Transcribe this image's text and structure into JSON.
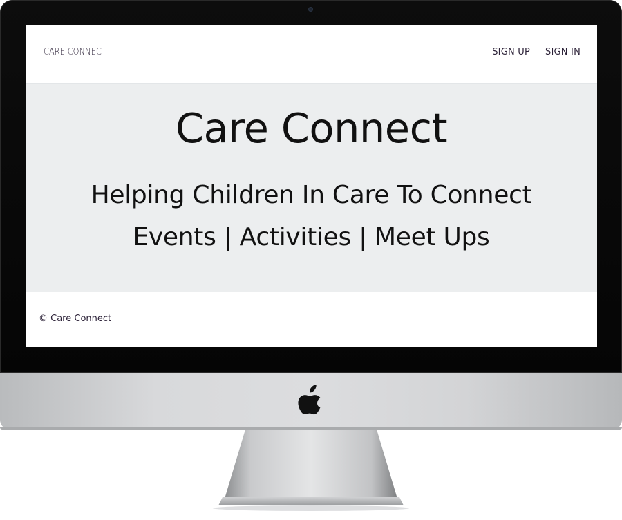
{
  "navbar": {
    "brand": "CARE CONNECT",
    "links": [
      {
        "label": "SIGN UP"
      },
      {
        "label": "SIGN IN"
      }
    ]
  },
  "hero": {
    "title": "Care Connect",
    "subtitle": "Helping Children In Care To Connect",
    "tagline": "Events | Activities | Meet Ups"
  },
  "footer": {
    "copyright": "© Care Connect"
  },
  "colors": {
    "hero_background": "#eceeef",
    "text_dark": "#111111",
    "nav_text": "#2c2238",
    "bezel": "#0d0d0d",
    "chin": "#d8d9db"
  },
  "icons": {
    "device_logo": "apple-logo-icon",
    "camera": "camera-icon"
  }
}
